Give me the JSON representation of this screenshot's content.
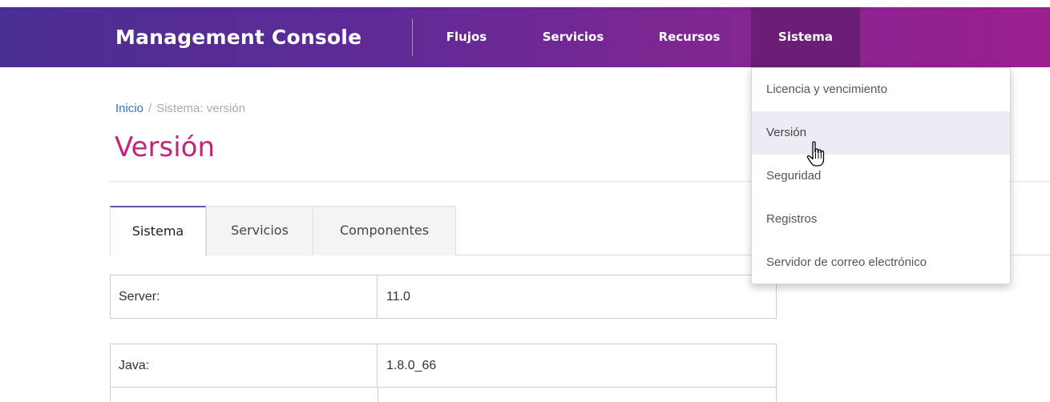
{
  "header": {
    "brand": "Management Console",
    "nav": [
      {
        "label": "Flujos"
      },
      {
        "label": "Servicios"
      },
      {
        "label": "Recursos"
      },
      {
        "label": "Sistema",
        "active": true
      }
    ]
  },
  "breadcrumb": {
    "home": "Inicio",
    "separator": "/",
    "current": "Sistema: versión"
  },
  "page": {
    "title": "Versión"
  },
  "tabs": [
    {
      "label": "Sistema",
      "active": true
    },
    {
      "label": "Servicios"
    },
    {
      "label": "Componentes"
    }
  ],
  "tables": [
    {
      "label": "Server:",
      "value": "11.0"
    },
    {
      "label": "Java:",
      "value": "1.8.0_66"
    }
  ],
  "dropdown": {
    "items": [
      {
        "label": "Licencia y vencimiento"
      },
      {
        "label": "Versión",
        "hovered": true
      },
      {
        "label": "Seguridad"
      },
      {
        "label": "Registros"
      },
      {
        "label": "Servidor de correo electrónico"
      }
    ]
  },
  "colors": {
    "navbar_start": "#4a2f92",
    "navbar_end": "#9c1f8f",
    "nav_active": "#6a1e75",
    "title": "#c1247d",
    "link": "#3a6fc4",
    "hover_row": "#ececf5"
  },
  "icons": {
    "cursor": "hand-pointer-icon"
  }
}
